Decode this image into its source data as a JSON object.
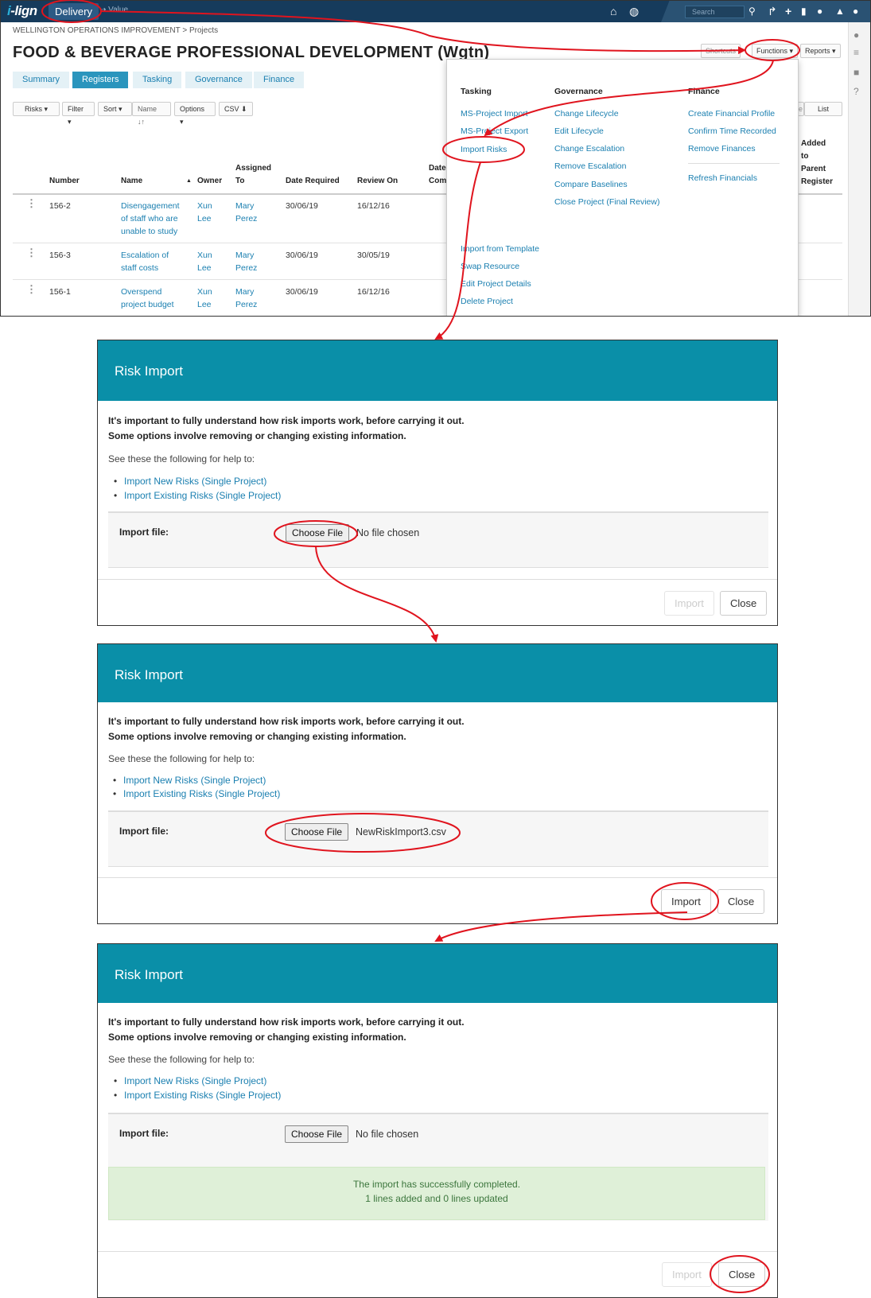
{
  "app": {
    "logo": {
      "prefix": "i",
      "main": "-lign"
    },
    "nav": {
      "delivery": "Delivery",
      "value": "Value"
    },
    "search_placeholder": "Search",
    "breadcrumb": "WELLINGTON OPERATIONS IMPROVEMENT > Projects",
    "title": "FOOD & BEVERAGE PROFESSIONAL DEVELOPMENT (Wgtn)",
    "tabs": [
      "Summary",
      "Registers",
      "Tasking",
      "Governance",
      "Finance"
    ],
    "active_tab": "Registers",
    "header_buttons": {
      "shortcuts": "Shortcuts",
      "functions": "Functions ▾",
      "reports": "Reports ▾"
    },
    "toolbar": {
      "risks": "Risks ▾",
      "filter": "Filter ▾",
      "sort": "Sort ▾",
      "sort_field": "Name ↓↑",
      "options": "Options ▾",
      "csv": "CSV"
    },
    "view_toggle": {
      "left": "e",
      "right": "List"
    },
    "columns": {
      "number": "Number",
      "name": "Name",
      "owner": "Owner",
      "assigned_1": "Assigned",
      "assigned_2": "To",
      "date_required": "Date Required",
      "review_on": "Review On",
      "date_com_1": "Date",
      "date_com_2": "Com",
      "added_1": "Added",
      "added_2": "to",
      "added_3": "Parent",
      "added_4": "Register"
    },
    "rows": [
      {
        "number": "156-2",
        "name": [
          "Disengagement",
          "of staff who are",
          "unable to study"
        ],
        "owner": [
          "Xun",
          "Lee"
        ],
        "assigned": [
          "Mary",
          "Perez"
        ],
        "date_required": "30/06/19",
        "review_on": "16/12/16"
      },
      {
        "number": "156-3",
        "name": [
          "Escalation of",
          "staff costs"
        ],
        "owner": [
          "Xun",
          "Lee"
        ],
        "assigned": [
          "Mary",
          "Perez"
        ],
        "date_required": "30/06/19",
        "review_on": "30/05/19"
      },
      {
        "number": "156-1",
        "name": [
          "Overspend",
          "project budget"
        ],
        "owner": [
          "Xun",
          "Lee"
        ],
        "assigned": [
          "Mary",
          "Perez"
        ],
        "date_required": "30/06/19",
        "review_on": "16/12/16"
      }
    ]
  },
  "functions_menu": {
    "tasking": {
      "heading": "Tasking",
      "items": [
        "MS-Project Import",
        "MS-Project Export",
        "Import Risks"
      ]
    },
    "governance": {
      "heading": "Governance",
      "items": [
        "Change Lifecycle",
        "Edit Lifecycle",
        "Change Escalation",
        "Remove Escalation",
        "Compare Baselines",
        "Close Project (Final Review)"
      ]
    },
    "finance": {
      "heading": "Finance",
      "items": [
        "Create Financial Profile",
        "Confirm Time Recorded",
        "Remove Finances"
      ],
      "extra": "Refresh Financials"
    },
    "other": [
      "Import from Template",
      "Swap Resource",
      "Edit Project Details",
      "Delete Project"
    ]
  },
  "dialog": {
    "title": "Risk Import",
    "warning_1": "It's important to fully understand how risk imports work, before carrying it out.",
    "warning_2": "Some options involve removing or changing existing information.",
    "see_help": "See these the following for help to:",
    "help_links": [
      "Import New Risks (Single Project)",
      "Import Existing Risks (Single Project)"
    ],
    "file_label": "Import file:",
    "choose_file": "Choose File",
    "no_file": "No file chosen",
    "selected_file": "NewRiskImport3.csv",
    "import": "Import",
    "close": "Close",
    "success_1": "The import has successfully completed.",
    "success_2": "1 lines added and 0 lines updated"
  },
  "colors": {
    "topbar": "#163b5c",
    "dialog_header": "#0a8fa8",
    "link": "#1a7fb0",
    "annotation": "#e0141e",
    "success_bg": "#dff0d8"
  }
}
